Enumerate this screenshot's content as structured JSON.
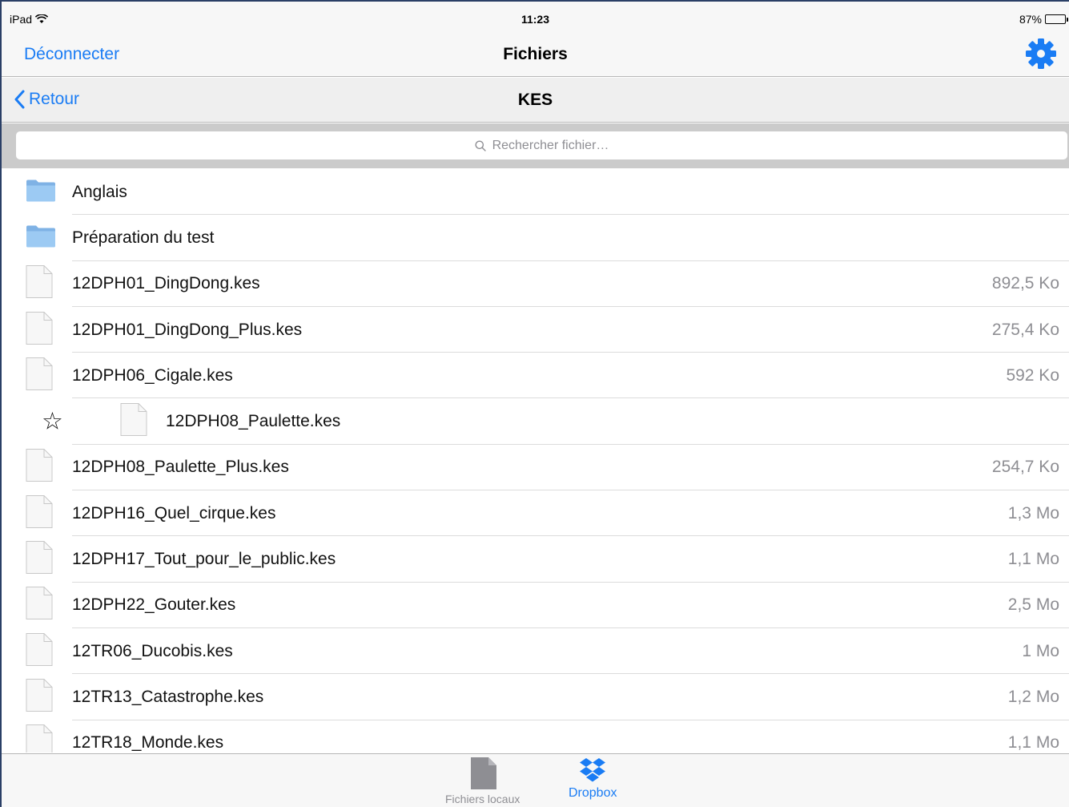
{
  "status": {
    "device": "iPad",
    "time": "11:23",
    "battery": "87%",
    "battery_level": 0.87
  },
  "navbar": {
    "left_button": "Déconnecter",
    "title": "Fichiers",
    "right_icon": "gear-icon"
  },
  "subnav": {
    "back_label": "Retour",
    "title": "KES"
  },
  "search": {
    "placeholder": "Rechercher fichier…"
  },
  "items": [
    {
      "type": "folder",
      "name": "Anglais",
      "size": ""
    },
    {
      "type": "folder",
      "name": "Préparation du test",
      "size": ""
    },
    {
      "type": "file",
      "name": "12DPH01_DingDong.kes",
      "size": "892,5 Ko"
    },
    {
      "type": "file",
      "name": "12DPH01_DingDong_Plus.kes",
      "size": "275,4 Ko"
    },
    {
      "type": "file",
      "name": "12DPH06_Cigale.kes",
      "size": "592 Ko"
    },
    {
      "type": "file",
      "name": "12DPH08_Paulette.kes",
      "size": "",
      "starred": true
    },
    {
      "type": "file",
      "name": "12DPH08_Paulette_Plus.kes",
      "size": "254,7 Ko"
    },
    {
      "type": "file",
      "name": "12DPH16_Quel_cirque.kes",
      "size": "1,3 Mo"
    },
    {
      "type": "file",
      "name": "12DPH17_Tout_pour_le_public.kes",
      "size": "1,1 Mo"
    },
    {
      "type": "file",
      "name": "12DPH22_Gouter.kes",
      "size": "2,5 Mo"
    },
    {
      "type": "file",
      "name": "12TR06_Ducobis.kes",
      "size": "1 Mo"
    },
    {
      "type": "file",
      "name": "12TR13_Catastrophe.kes",
      "size": "1,2 Mo"
    },
    {
      "type": "file",
      "name": "12TR18_Monde.kes",
      "size": "1,1 Mo"
    }
  ],
  "tabs": [
    {
      "label": "Fichiers locaux",
      "icon": "document-icon",
      "active": false
    },
    {
      "label": "Dropbox",
      "icon": "dropbox-icon",
      "active": true
    }
  ],
  "colors": {
    "accent": "#1a7cf4",
    "secondary_text": "#8e8e93"
  }
}
